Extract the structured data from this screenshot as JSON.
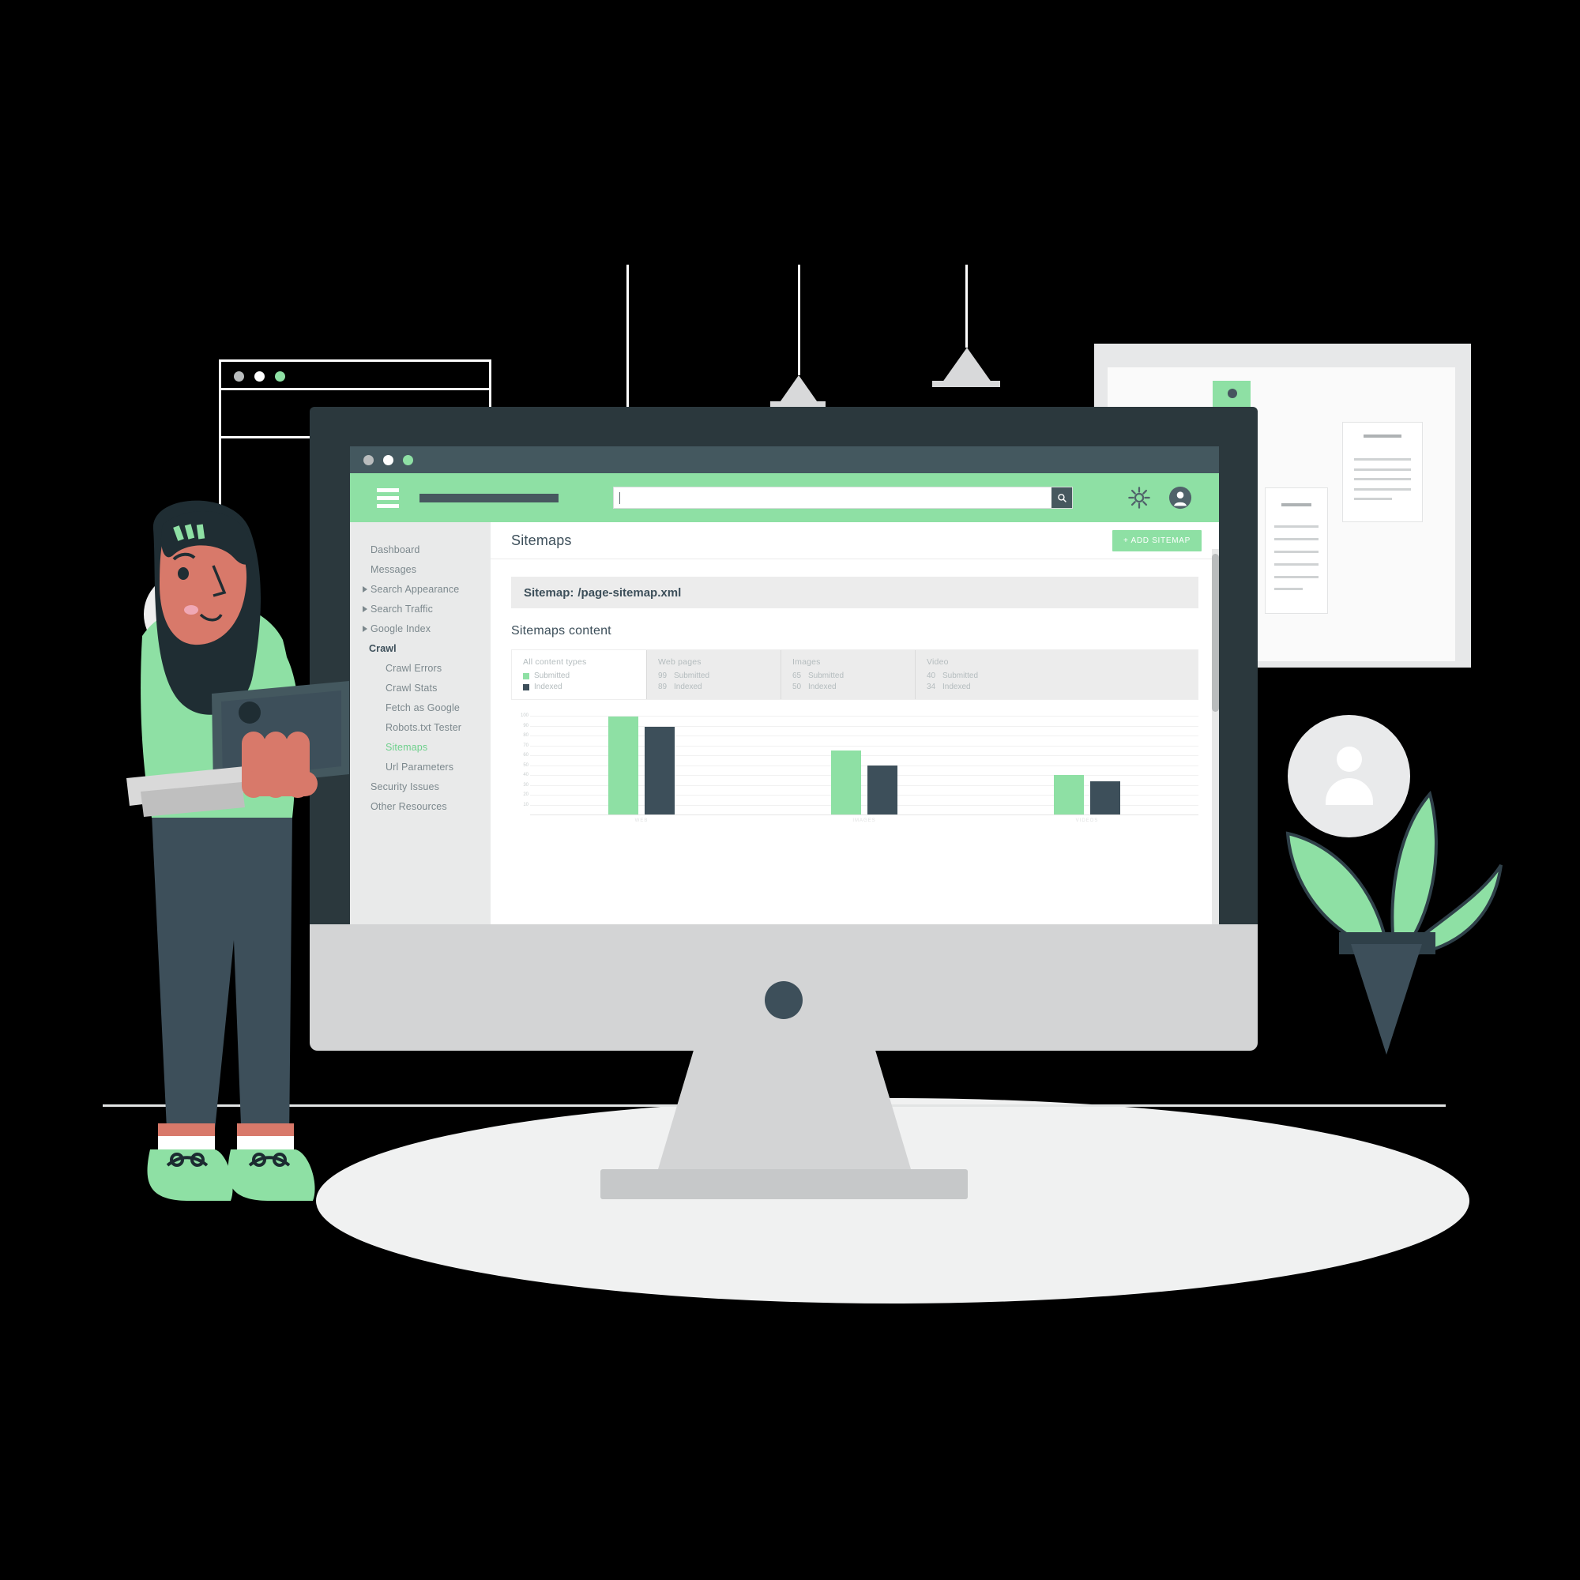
{
  "window": {
    "title_dots": [
      "dot-grey",
      "dot-white",
      "dot-green"
    ]
  },
  "appbar": {
    "menu_icon": "hamburger-icon",
    "brand_placeholder": "",
    "search": {
      "value": "",
      "placeholder": "",
      "button_icon": "search-icon"
    },
    "settings_icon": "gear-icon",
    "account_icon": "user-avatar-icon"
  },
  "sidebar": {
    "items": [
      {
        "label": "Dashboard",
        "expandable": false,
        "level": 0,
        "active": false
      },
      {
        "label": "Messages",
        "expandable": false,
        "level": 0,
        "active": false
      },
      {
        "label": "Search Appearance",
        "expandable": true,
        "level": 0,
        "active": false
      },
      {
        "label": "Search Traffic",
        "expandable": true,
        "level": 0,
        "active": false
      },
      {
        "label": "Google Index",
        "expandable": true,
        "level": 0,
        "active": false
      },
      {
        "label": "Crawl",
        "expandable": true,
        "level": 0,
        "active": false,
        "header": true
      },
      {
        "label": "Crawl Errors",
        "expandable": false,
        "level": 1,
        "active": false
      },
      {
        "label": "Crawl Stats",
        "expandable": false,
        "level": 1,
        "active": false
      },
      {
        "label": "Fetch as Google",
        "expandable": false,
        "level": 1,
        "active": false
      },
      {
        "label": "Robots.txt Tester",
        "expandable": false,
        "level": 1,
        "active": false
      },
      {
        "label": "Sitemaps",
        "expandable": false,
        "level": 1,
        "active": true
      },
      {
        "label": "Url Parameters",
        "expandable": false,
        "level": 1,
        "active": false
      },
      {
        "label": "Security Issues",
        "expandable": false,
        "level": 0,
        "active": false
      },
      {
        "label": "Other Resources",
        "expandable": false,
        "level": 0,
        "active": false
      }
    ]
  },
  "content": {
    "page_title": "Sitemaps",
    "add_button_label": "+ ADD SITEMAP",
    "sitemap_bar": {
      "label": "Sitemap:",
      "value": "/page-sitemap.xml"
    },
    "section_title": "Sitemaps content",
    "stats": {
      "legend_col": {
        "title": "All content types",
        "submitted_label": "Submitted",
        "indexed_label": "Indexed"
      },
      "columns": [
        {
          "title": "Web pages",
          "submitted": "99",
          "submitted_label": "Submitted",
          "indexed": "89",
          "indexed_label": "Indexed"
        },
        {
          "title": "Images",
          "submitted": "65",
          "submitted_label": "Submitted",
          "indexed": "50",
          "indexed_label": "Indexed"
        },
        {
          "title": "Video",
          "submitted": "40",
          "submitted_label": "Submitted",
          "indexed": "34",
          "indexed_label": "Indexed"
        }
      ]
    }
  },
  "chart_data": {
    "type": "bar",
    "title": "Sitemaps content",
    "categories": [
      "WEB",
      "IMAGES",
      "VIDEOS"
    ],
    "series": [
      {
        "name": "Submitted",
        "color": "#8ee0a4",
        "values": [
          99,
          65,
          40
        ]
      },
      {
        "name": "Indexed",
        "color": "#3d4f5a",
        "values": [
          89,
          50,
          34
        ]
      }
    ],
    "ylim": [
      0,
      100
    ],
    "yticks": [
      100,
      90,
      80,
      70,
      60,
      50,
      40,
      30,
      20,
      10
    ],
    "xlabel": "",
    "ylabel": "",
    "grid": true,
    "legend_position": "stats-panel"
  },
  "colors": {
    "brand_green": "#8ee0a4",
    "dark_slate": "#3d4f5a",
    "titlebar": "#44585f",
    "monitor_body": "#2b383d",
    "sidebar_bg": "#e9eaea",
    "muted_text": "#7c888d"
  }
}
